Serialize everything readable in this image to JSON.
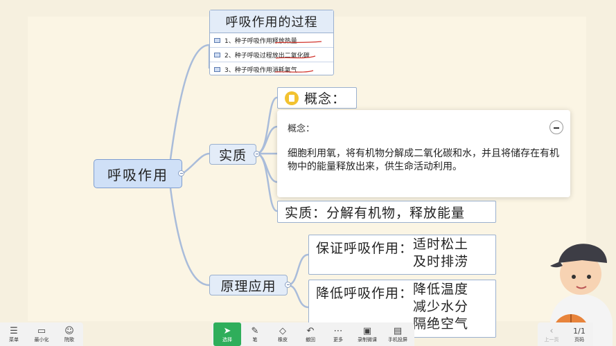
{
  "mindmap": {
    "root": "呼吸作用",
    "top_branch": {
      "title": "呼吸作用的过程",
      "items": [
        "1、种子呼吸作用释放热量",
        "2、种子呼吸过程放出二氧化碳",
        "3、种子呼吸作用消耗氧气"
      ]
    },
    "essence": {
      "label": "实质",
      "concept_label": "概念：",
      "summary": "实质：分解有机物，释放能量"
    },
    "application": {
      "label": "原理应用",
      "item1_title": "保证呼吸作用：",
      "item1_lines": [
        "适时松土",
        "及时排涝"
      ],
      "item2_title": "降低呼吸作用：",
      "item2_lines": [
        "降低温度",
        "减少水分",
        "隔绝空气"
      ]
    }
  },
  "popup": {
    "title": "概念：",
    "body": "细胞利用氧，将有机物分解成二氧化碳和水，并且将储存在有机物中的能量释放出来，供生命活动利用。"
  },
  "toolbar_left": [
    {
      "label": "菜单",
      "icon": "menu-icon"
    },
    {
      "label": "最小化",
      "icon": "minimize-icon"
    },
    {
      "label": "院歌",
      "icon": "avatar-icon"
    }
  ],
  "toolbar_center": [
    {
      "label": "选择",
      "icon": "cursor-icon"
    },
    {
      "label": "笔",
      "icon": "pen-icon"
    },
    {
      "label": "橡皮",
      "icon": "eraser-icon"
    },
    {
      "label": "撤回",
      "icon": "undo-icon"
    },
    {
      "label": "更多",
      "icon": "more-icon"
    },
    {
      "label": "录制微课",
      "icon": "record-icon"
    },
    {
      "label": "手机投屏",
      "icon": "cast-icon"
    }
  ],
  "pager": {
    "prev": "上一页",
    "page": "1/1",
    "next": "页码"
  },
  "colors": {
    "accent": "#2fae5b",
    "node_fill": "#e3ecf8",
    "root_fill": "#cfe0f7",
    "line": "#9ab0cf"
  }
}
